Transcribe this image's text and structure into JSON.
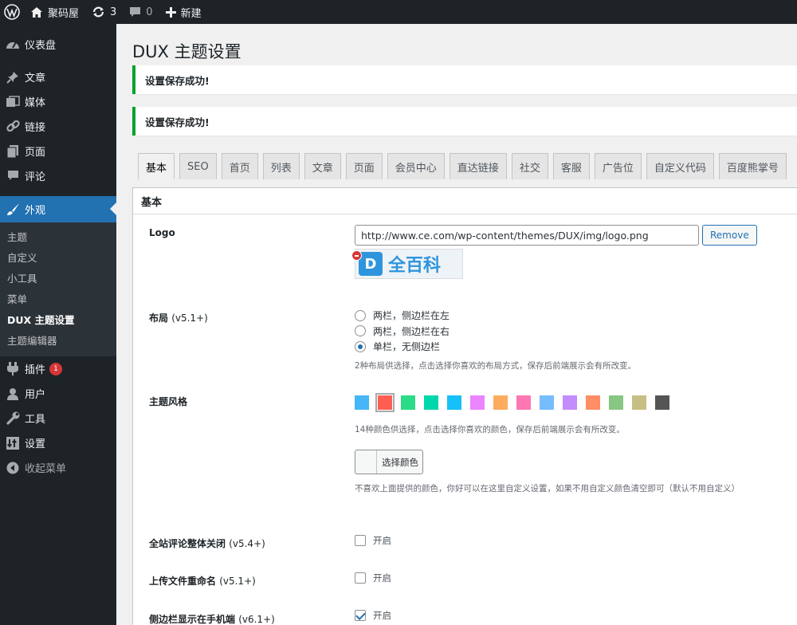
{
  "adminbar": {
    "site_name": "聚码屋",
    "updates_count": "3",
    "comments_count": "0",
    "new_label": "新建"
  },
  "sidebar": {
    "items": [
      {
        "label": "仪表盘",
        "icon": "dashboard-icon"
      },
      {
        "label": "文章",
        "icon": "pin-icon"
      },
      {
        "label": "媒体",
        "icon": "media-icon"
      },
      {
        "label": "链接",
        "icon": "link-icon"
      },
      {
        "label": "页面",
        "icon": "page-icon"
      },
      {
        "label": "评论",
        "icon": "comment-icon"
      },
      {
        "label": "外观",
        "icon": "brush-icon"
      },
      {
        "label": "插件",
        "icon": "plugin-icon",
        "badge": "1"
      },
      {
        "label": "用户",
        "icon": "user-icon"
      },
      {
        "label": "工具",
        "icon": "wrench-icon"
      },
      {
        "label": "设置",
        "icon": "settings-icon"
      },
      {
        "label": "收起菜单",
        "icon": "collapse-icon"
      }
    ],
    "submenu": [
      "主题",
      "自定义",
      "小工具",
      "菜单",
      "DUX 主题设置",
      "主题编辑器"
    ]
  },
  "page": {
    "title": "DUX 主题设置",
    "notices": [
      "设置保存成功!",
      "设置保存成功!"
    ]
  },
  "tabs": [
    "基本",
    "SEO",
    "首页",
    "列表",
    "文章",
    "页面",
    "会员中心",
    "直达链接",
    "社交",
    "客服",
    "广告位",
    "自定义代码",
    "百度熊掌号"
  ],
  "section": {
    "title": "基本",
    "logo": {
      "label": "Logo",
      "value": "http://www.ce.com/wp-content/themes/DUX/img/logo.png",
      "remove_label": "Remove",
      "preview_mark": "D",
      "preview_text": "全百科"
    },
    "layout": {
      "label": "布局",
      "version": "(v5.1+)",
      "options": [
        "两栏，侧边栏在左",
        "两栏，侧边栏在右",
        "单栏，无侧边栏"
      ],
      "selected_index": 2,
      "desc": "2种布局供选择，点击选择你喜欢的布局方式，保存后前端展示会有所改变。"
    },
    "theme_style": {
      "label": "主题风格",
      "colors": [
        "#45b6f7",
        "#ff5e52",
        "#2cdb87",
        "#00d6ac",
        "#16c0f8",
        "#ea84ff",
        "#fdac5f",
        "#fd77b2",
        "#76bdff",
        "#c38cff",
        "#ff8d66",
        "#88c683",
        "#c6bf84",
        "#555555"
      ],
      "selected_index": 1,
      "desc": "14种颜色供选择，点击选择你喜欢的颜色，保存后前端展示会有所改变。",
      "pick_label": "选择颜色",
      "custom_desc": "不喜欢上面提供的颜色，你好可以在这里自定义设置，如果不用自定义颜色清空即可（默认不用自定义）"
    },
    "options": [
      {
        "label": "全站评论整体关闭",
        "version": "(v5.4+)",
        "check_label": "开启",
        "checked": false
      },
      {
        "label": "上传文件重命名",
        "version": "(v5.1+)",
        "check_label": "开启",
        "checked": false
      },
      {
        "label": "侧边栏显示在手机端",
        "version": "(v6.1+)",
        "check_label": "开启",
        "checked": true
      }
    ]
  }
}
